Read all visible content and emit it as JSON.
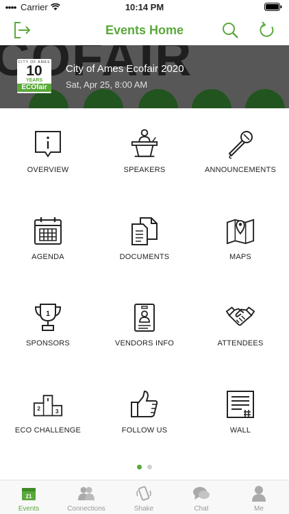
{
  "status_bar": {
    "carrier": "Carrier",
    "time": "10:14 PM"
  },
  "nav": {
    "title": "Events Home"
  },
  "event": {
    "title": "City of Ames Ecofair 2020",
    "date": "Sat, Apr 25, 8:00 AM",
    "logo": {
      "line1": "CITY OF AMES",
      "line2": "10",
      "line3": "YEARS",
      "line4": "ECOfair"
    },
    "banner_text": "COFAIR"
  },
  "grid": [
    {
      "label": "OVERVIEW",
      "icon": "overview-icon"
    },
    {
      "label": "SPEAKERS",
      "icon": "podium-icon"
    },
    {
      "label": "ANNOUNCEMENTS",
      "icon": "microphone-icon"
    },
    {
      "label": "AGENDA",
      "icon": "calendar-icon"
    },
    {
      "label": "DOCUMENTS",
      "icon": "documents-icon"
    },
    {
      "label": "MAPS",
      "icon": "map-icon"
    },
    {
      "label": "SPONSORS",
      "icon": "trophy-icon"
    },
    {
      "label": "VENDORS INFO",
      "icon": "badge-icon"
    },
    {
      "label": "ATTENDEES",
      "icon": "handshake-icon"
    },
    {
      "label": "ECO CHALLENGE",
      "icon": "podium-ranking-icon"
    },
    {
      "label": "FOLLOW US",
      "icon": "thumbs-up-icon"
    },
    {
      "label": "WALL",
      "icon": "wall-icon"
    }
  ],
  "pager": {
    "active_page": 1,
    "page_count": 2
  },
  "tabs": [
    {
      "label": "Events",
      "icon": "calendar-tab-icon",
      "badge": "21",
      "active": true
    },
    {
      "label": "Connections",
      "icon": "people-icon",
      "active": false
    },
    {
      "label": "Shake",
      "icon": "shake-phone-icon",
      "active": false
    },
    {
      "label": "Chat",
      "icon": "chat-icon",
      "active": false
    },
    {
      "label": "Me",
      "icon": "person-icon",
      "active": false
    }
  ],
  "colors": {
    "accent": "#5aa83a",
    "tab_inactive": "#999999"
  }
}
